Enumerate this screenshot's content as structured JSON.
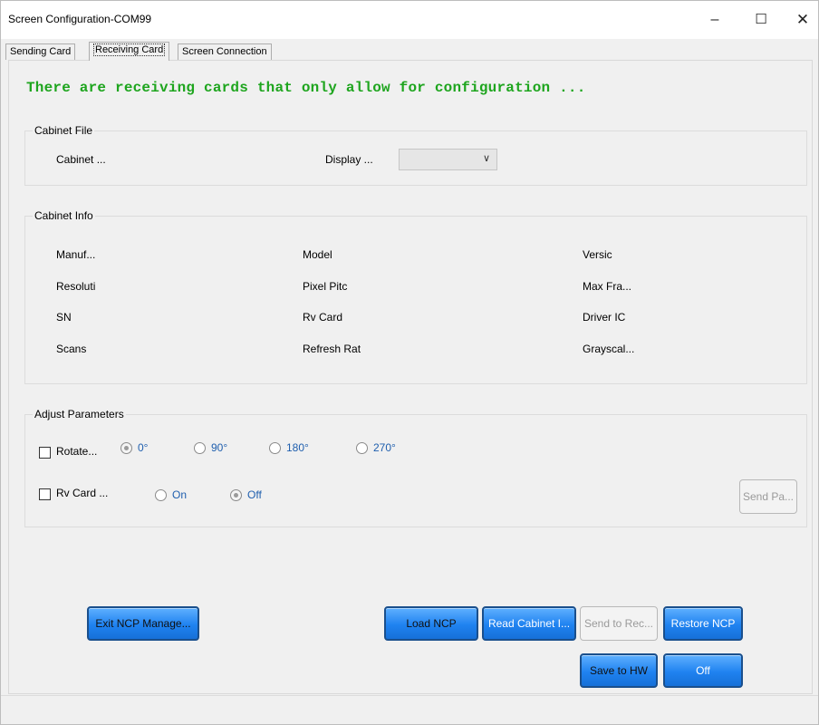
{
  "window": {
    "title": "Screen Configuration-COM99",
    "minimize_glyph": "–",
    "maximize_glyph": "☐",
    "close_glyph": "✕"
  },
  "tabs": [
    {
      "label": "Sending Card",
      "active": false
    },
    {
      "label": "Receiving Card",
      "active": true
    },
    {
      "label": "Screen Connection",
      "active": false
    }
  ],
  "headline": {
    "text": "There are receiving cards that only allow for configuration ...",
    "color": "#1ea51e"
  },
  "cabinet_file": {
    "group_label": "Cabinet File",
    "cabinet_label": "Cabinet ...",
    "display_label": "Display ...",
    "display_select_value": "",
    "chevron_icon": "chevron-down-icon"
  },
  "cabinet_info": {
    "group_label": "Cabinet Info",
    "rows": [
      [
        "Manuf...",
        "Model",
        "Versic"
      ],
      [
        "Resoluti",
        "Pixel Pitc",
        "Max Fra..."
      ],
      [
        "SN",
        "Rv Card",
        "Driver IC"
      ],
      [
        "Scans",
        "Refresh Rat",
        "Grayscal..."
      ]
    ]
  },
  "adjust": {
    "group_label": "Adjust Parameters",
    "rotate_label": "Rotate...",
    "rotate_checked": false,
    "rotate_options": [
      "0°",
      "90°",
      "180°",
      "270°"
    ],
    "rotate_selected": "0°",
    "rv_label": "Rv Card ...",
    "rv_checked": false,
    "rv_options": [
      "On",
      "Off"
    ],
    "rv_selected": "Off",
    "send_button": "Send Pa..."
  },
  "buttons": {
    "exit_ncp": "Exit NCP Manage...",
    "load_ncp": "Load NCP",
    "read_cabinet": "Read Cabinet I...",
    "send_to_rec": "Send to Rec...",
    "restore_ncp": "Restore NCP",
    "save_to_hw": "Save to HW",
    "off": "Off"
  },
  "colors": {
    "button_blue": "#1f82f0",
    "option_text": "#1f5fae"
  }
}
